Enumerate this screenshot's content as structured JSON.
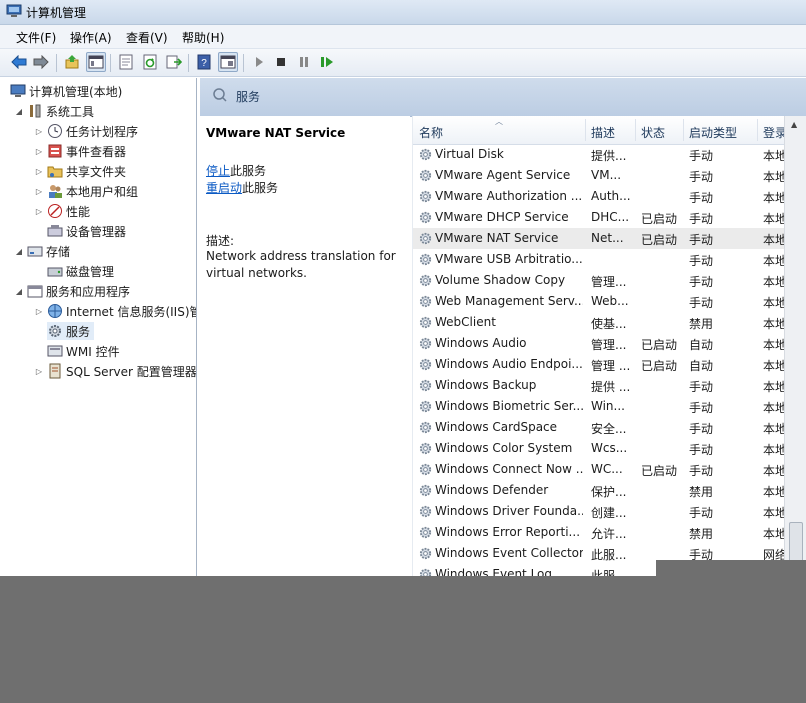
{
  "window": {
    "title": "计算机管理"
  },
  "menu": [
    "文件(F)",
    "操作(A)",
    "查看(V)",
    "帮助(H)"
  ],
  "toolbar": {
    "icons": [
      "back-icon",
      "forward-icon",
      "up-icon",
      "show-hide-tree-icon",
      "properties-icon",
      "refresh-icon",
      "export-icon",
      "help-icon",
      "view-icon",
      "start-service-icon",
      "stop-service-icon",
      "pause-service-icon",
      "restart-service-icon"
    ]
  },
  "tree": {
    "root": "计算机管理(本地)",
    "system_tools": "系统工具",
    "task_scheduler": "任务计划程序",
    "event_viewer": "事件查看器",
    "shared_folders": "共享文件夹",
    "local_users": "本地用户和组",
    "performance": "性能",
    "device_manager": "设备管理器",
    "storage": "存储",
    "disk_management": "磁盘管理",
    "services_apps": "服务和应用程序",
    "iis": "Internet 信息服务(IIS)管",
    "services": "服务",
    "wmi": "WMI 控件",
    "sql": "SQL Server 配置管理器"
  },
  "pane_header": "服务",
  "detail": {
    "service_name": "VMware NAT Service",
    "stop_link": "停止",
    "stop_suffix": "此服务",
    "restart_link": "重启动",
    "restart_suffix": "此服务",
    "desc_label": "描述:",
    "desc_text": "Network address translation for virtual networks."
  },
  "columns": {
    "name": "名称",
    "desc": "描述",
    "status": "状态",
    "startup": "启动类型",
    "logon": "登录"
  },
  "services": [
    {
      "name": "Virtual Disk",
      "desc": "提供...",
      "status": "",
      "startup": "手动",
      "logon": "本地"
    },
    {
      "name": "VMware Agent Service",
      "desc": "VM...",
      "status": "",
      "startup": "手动",
      "logon": "本地"
    },
    {
      "name": "VMware Authorization ...",
      "desc": "Auth...",
      "status": "",
      "startup": "手动",
      "logon": "本地"
    },
    {
      "name": "VMware DHCP Service",
      "desc": "DHC...",
      "status": "已启动",
      "startup": "手动",
      "logon": "本地"
    },
    {
      "name": "VMware NAT Service",
      "desc": "Net...",
      "status": "已启动",
      "startup": "手动",
      "logon": "本地"
    },
    {
      "name": "VMware USB Arbitratio...",
      "desc": "",
      "status": "",
      "startup": "手动",
      "logon": "本地"
    },
    {
      "name": "Volume Shadow Copy",
      "desc": "管理...",
      "status": "",
      "startup": "手动",
      "logon": "本地"
    },
    {
      "name": "Web Management Serv...",
      "desc": "Web...",
      "status": "",
      "startup": "手动",
      "logon": "本地"
    },
    {
      "name": "WebClient",
      "desc": "使基...",
      "status": "",
      "startup": "禁用",
      "logon": "本地"
    },
    {
      "name": "Windows Audio",
      "desc": "管理...",
      "status": "已启动",
      "startup": "自动",
      "logon": "本地"
    },
    {
      "name": "Windows Audio Endpoi...",
      "desc": "管理 ...",
      "status": "已启动",
      "startup": "自动",
      "logon": "本地"
    },
    {
      "name": "Windows Backup",
      "desc": "提供 ...",
      "status": "",
      "startup": "手动",
      "logon": "本地"
    },
    {
      "name": "Windows Biometric Ser...",
      "desc": "Win...",
      "status": "",
      "startup": "手动",
      "logon": "本地"
    },
    {
      "name": "Windows CardSpace",
      "desc": "安全...",
      "status": "",
      "startup": "手动",
      "logon": "本地"
    },
    {
      "name": "Windows Color System",
      "desc": "Wcs...",
      "status": "",
      "startup": "手动",
      "logon": "本地"
    },
    {
      "name": "Windows Connect Now ...",
      "desc": "WC...",
      "status": "已启动",
      "startup": "手动",
      "logon": "本地"
    },
    {
      "name": "Windows Defender",
      "desc": "保护...",
      "status": "",
      "startup": "禁用",
      "logon": "本地"
    },
    {
      "name": "Windows Driver Founda...",
      "desc": "创建...",
      "status": "",
      "startup": "手动",
      "logon": "本地"
    },
    {
      "name": "Windows Error Reporti...",
      "desc": "允许...",
      "status": "",
      "startup": "禁用",
      "logon": "本地"
    },
    {
      "name": "Windows Event Collector",
      "desc": "此服...",
      "status": "",
      "startup": "手动",
      "logon": "网络"
    },
    {
      "name": "Windows Event Log",
      "desc": "此服...",
      "status": "",
      "startup": "",
      "logon": ""
    }
  ],
  "colors": {
    "titlebar": "#c9d8ea",
    "header": "#bccde3",
    "link": "#0b5ac4",
    "selected_row": "#ebebeb"
  }
}
